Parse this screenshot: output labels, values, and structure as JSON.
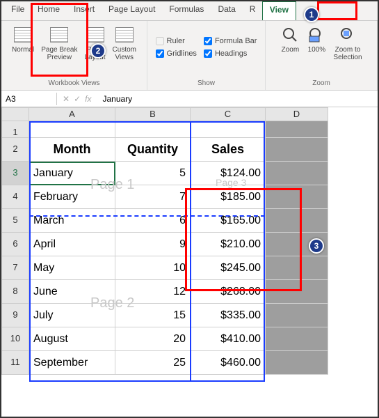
{
  "tabs": {
    "file": "File",
    "home": "Home",
    "insert": "Insert",
    "page_layout": "Page Layout",
    "formulas": "Formulas",
    "data": "Data",
    "review": "R",
    "view": "View"
  },
  "ribbon": {
    "views": {
      "normal": "Normal",
      "page_break_l1": "Page Break",
      "page_break_l2": "Preview",
      "page_layout_l1": "Page",
      "page_layout_l2": "Layout",
      "custom_l1": "Custom",
      "custom_l2": "Views",
      "group_label": "Workbook Views"
    },
    "show": {
      "ruler": "Ruler",
      "gridlines": "Gridlines",
      "formula_bar": "Formula Bar",
      "headings": "Headings",
      "group_label": "Show"
    },
    "zoom": {
      "zoom": "Zoom",
      "hundred": "100%",
      "zoom_sel_l1": "Zoom to",
      "zoom_sel_l2": "Selection",
      "group_label": "Zoom"
    }
  },
  "fbar": {
    "name": "A3",
    "fx": "fx",
    "value": "January"
  },
  "cols": {
    "A": "A",
    "B": "B",
    "C": "C",
    "D": "D"
  },
  "headers": {
    "month": "Month",
    "quantity": "Quantity",
    "sales": "Sales"
  },
  "annot": {
    "n1": "1",
    "n2": "2",
    "n3": "3"
  },
  "watermarks": {
    "p1": "Page 1",
    "p2": "Page 2",
    "p3": "Page 3"
  },
  "rows": [
    {
      "n": "1",
      "month": "",
      "qty": "",
      "sales": ""
    },
    {
      "n": "2",
      "month": "",
      "qty": "",
      "sales": ""
    },
    {
      "n": "3",
      "month": "January",
      "qty": "5",
      "sales": "$124.00"
    },
    {
      "n": "4",
      "month": "February",
      "qty": "7",
      "sales": "$185.00"
    },
    {
      "n": "5",
      "month": "March",
      "qty": "6",
      "sales": "$165.00"
    },
    {
      "n": "6",
      "month": "April",
      "qty": "9",
      "sales": "$210.00"
    },
    {
      "n": "7",
      "month": "May",
      "qty": "10",
      "sales": "$245.00"
    },
    {
      "n": "8",
      "month": "June",
      "qty": "12",
      "sales": "$268.00"
    },
    {
      "n": "9",
      "month": "July",
      "qty": "15",
      "sales": "$335.00"
    },
    {
      "n": "10",
      "month": "August",
      "qty": "20",
      "sales": "$410.00"
    },
    {
      "n": "11",
      "month": "September",
      "qty": "25",
      "sales": "$460.00"
    }
  ],
  "chart_data": {
    "type": "table",
    "title": "",
    "columns": [
      "Month",
      "Quantity",
      "Sales"
    ],
    "rows": [
      [
        "January",
        5,
        124.0
      ],
      [
        "February",
        7,
        185.0
      ],
      [
        "March",
        6,
        165.0
      ],
      [
        "April",
        9,
        210.0
      ],
      [
        "May",
        10,
        245.0
      ],
      [
        "June",
        12,
        268.0
      ],
      [
        "July",
        15,
        335.0
      ],
      [
        "August",
        20,
        410.0
      ],
      [
        "September",
        25,
        460.0
      ]
    ]
  }
}
